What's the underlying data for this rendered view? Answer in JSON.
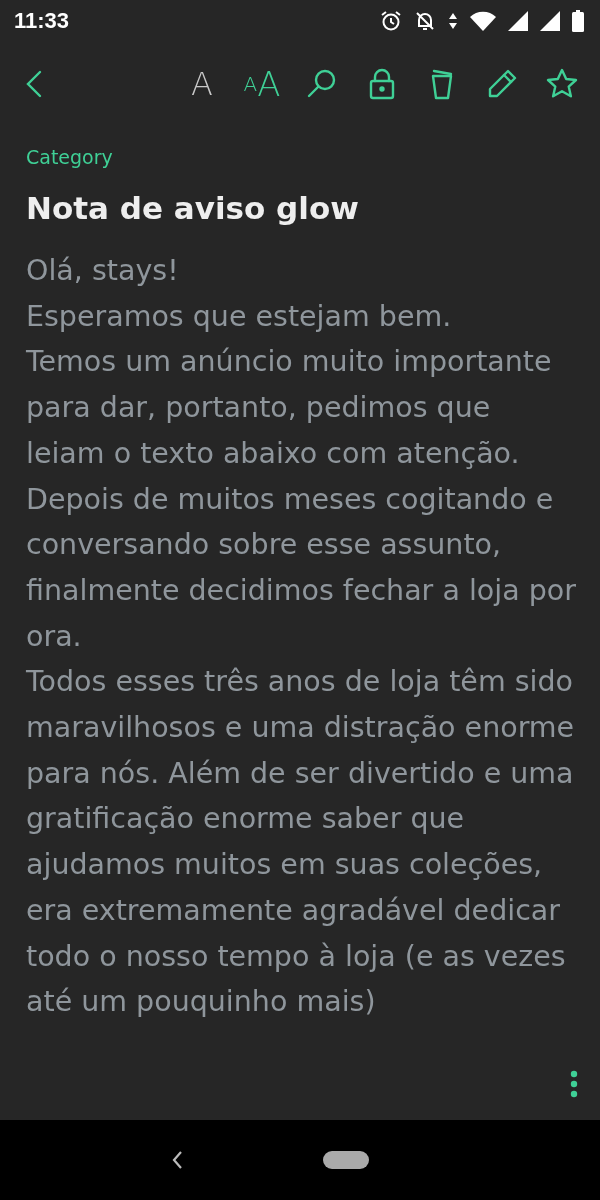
{
  "status_bar": {
    "time": "11:33"
  },
  "toolbar": {
    "items": [
      {
        "kind": "font",
        "label": "A",
        "active": false
      },
      {
        "kind": "text-size",
        "small": "A",
        "label": "A",
        "active": true
      },
      {
        "kind": "search",
        "active": true
      },
      {
        "kind": "lock",
        "active": true
      },
      {
        "kind": "delete",
        "active": true
      },
      {
        "kind": "edit",
        "active": true
      },
      {
        "kind": "star",
        "active": true
      }
    ]
  },
  "note": {
    "category": "Category",
    "title": "Nota de aviso glow",
    "paragraphs": [
      "Olá, stays!",
      "Esperamos que estejam bem.",
      "Temos um anúncio muito importante para dar, portanto, pedimos que leiam o texto abaixo com atenção.",
      "Depois de muitos meses cogitando e conversando sobre esse assunto, finalmente decidimos fechar a loja por ora.",
      "Todos esses três anos de loja têm sido maravilhosos e uma distração enorme para nós. Além de ser divertido e uma gratificação enorme saber que ajudamos muitos em suas coleções, era extremamente agradável dedicar todo o nosso tempo à loja (e as vezes até um pouquinho mais)"
    ]
  }
}
